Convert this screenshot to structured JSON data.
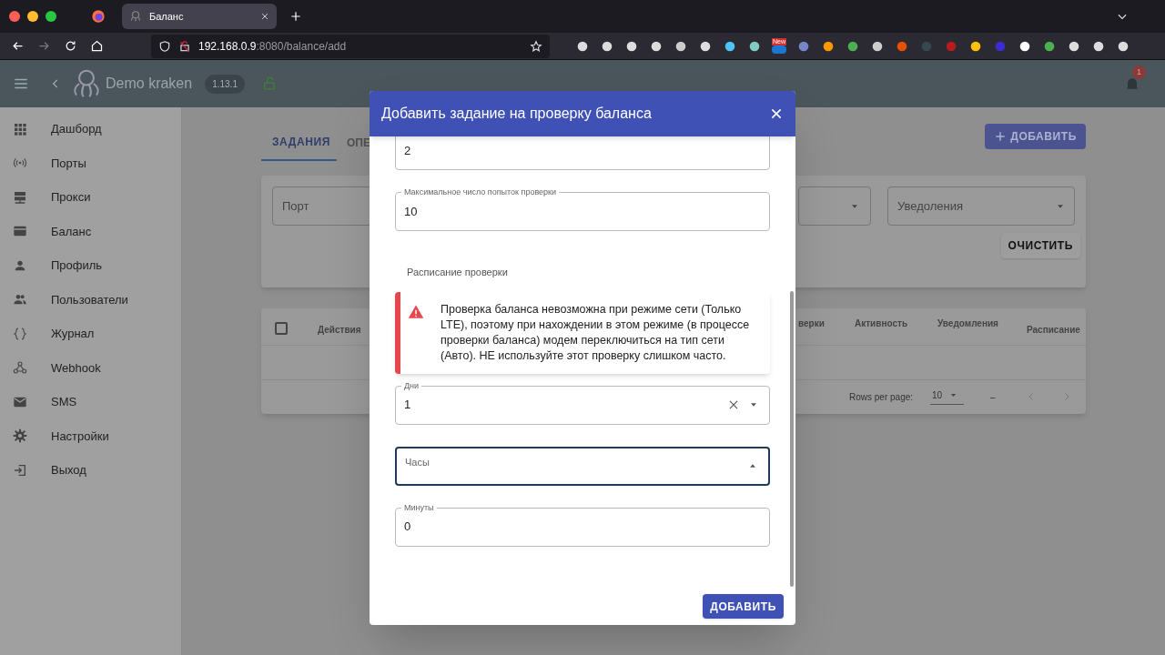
{
  "browser": {
    "tab_title": "Баланс",
    "address_host": "192.168.0.9",
    "address_rest": ":8080/balance/add",
    "extension_badge": "New"
  },
  "app_header": {
    "title": "Demo kraken",
    "version": "1.13.1",
    "notification_count": "1"
  },
  "sidebar": {
    "items": [
      {
        "label": "Дашборд",
        "kind": "grid"
      },
      {
        "label": "Порты",
        "kind": "signal"
      },
      {
        "label": "Прокси",
        "kind": "server"
      },
      {
        "label": "Баланс",
        "kind": "card"
      },
      {
        "label": "Профиль",
        "kind": "person"
      },
      {
        "label": "Пользователи",
        "kind": "people"
      },
      {
        "label": "Журнал",
        "kind": "braces"
      },
      {
        "label": "Webhook",
        "kind": "webhook"
      },
      {
        "label": "SMS",
        "kind": "mail"
      },
      {
        "label": "Настройки",
        "kind": "gear"
      },
      {
        "label": "Выход",
        "kind": "exit"
      }
    ]
  },
  "page": {
    "tabs": [
      {
        "label": "ЗАДАНИЯ",
        "selected": true
      },
      {
        "label": "ОПЕ",
        "selected": false
      }
    ],
    "add_button": "ДОБАВИТЬ",
    "filters": [
      {
        "kind": "text",
        "label": "Порт"
      },
      {
        "kind": "select",
        "label": "Уведоления"
      }
    ],
    "clear_button": "ОЧИСТИТЬ",
    "table": {
      "select_all_checked": false,
      "columns": [
        "Действия",
        "верки",
        "Активность",
        "Уведомления",
        "Расписание"
      ]
    },
    "pagination": {
      "rows_per_page_label": "Rows per page:",
      "rows_per_page": "10",
      "range": "–"
    }
  },
  "dialog": {
    "title": "Добавить задание на проверку баланса",
    "fields": [
      {
        "kind": "text",
        "value": "2"
      },
      {
        "kind": "text",
        "label": "Максимальное число попыток проверки",
        "value": "10"
      }
    ],
    "section_title": "Расписание проверки",
    "alert": "Проверка баланса невозможна при режиме сети (Только LTE), поэтому при нахождении в этом режиме (в процессе проверки баланса) модем переключиться на тип сети (Авто). НЕ используйте этот проверку слишком часто.",
    "selects": [
      {
        "kind": "select",
        "label": "Дни",
        "value": "1",
        "clearable": true,
        "focused": false
      },
      {
        "kind": "select",
        "label": "Часы",
        "focused": true,
        "clearable": false
      },
      {
        "kind": "text",
        "label": "Минуты",
        "value": "0",
        "focused": false
      }
    ],
    "submit_button": "ДОБАВИТЬ"
  }
}
